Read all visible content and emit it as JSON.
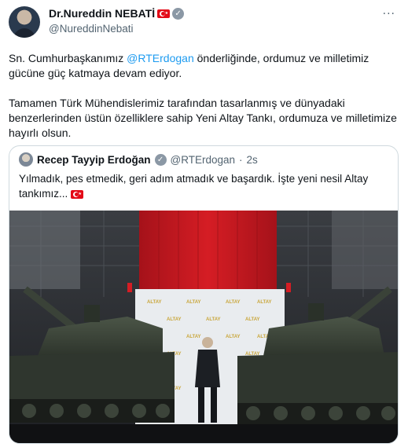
{
  "author": {
    "name": "Dr.Nureddin NEBATİ",
    "handle": "@NureddinNebati",
    "more_label": "···"
  },
  "tweet": {
    "para1_before": "Sn. Cumhurbaşkanımız ",
    "para1_mention": "@RTErdogan",
    "para1_after": " önderliğinde, ordumuz ve milletimiz gücüne güç katmaya devam ediyor.",
    "para2": "Tamamen Türk Mühendislerimiz tarafından tasarlanmış ve dünyadaki benzerlerinden üstün özelliklere sahip Yeni Altay Tankı, ordumuza ve milletimize hayırlı olsun."
  },
  "quoted": {
    "name": "Recep Tayyip Erdoğan",
    "handle": "@RTErdogan",
    "sep": "·",
    "time": "2s",
    "text": "Yılmadık, pes etmedik, geri adım atmadık ve başardık. İşte yeni nesil Altay tankımız..."
  },
  "media": {
    "backdrop_logo": "ALTAY"
  },
  "colors": {
    "accent": "#1d9bf0",
    "flag_red": "#e30a17",
    "banner_red": "#c0161d"
  },
  "icons": {
    "verified": "verified-badge-icon",
    "flag": "turkey-flag-icon"
  }
}
